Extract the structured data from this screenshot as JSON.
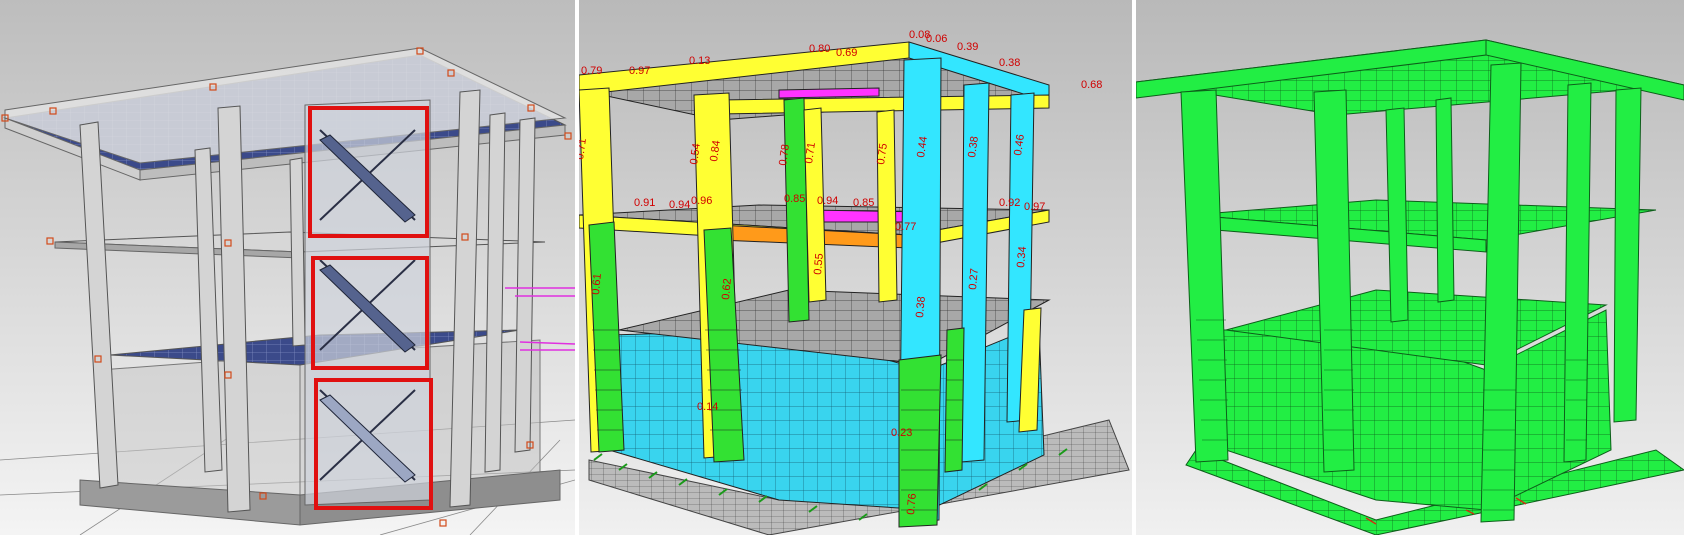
{
  "panels": [
    {
      "id": "geometry",
      "role": "3D structural model with highlighted staircases"
    },
    {
      "id": "utilization",
      "role": "element utilization ratio view"
    },
    {
      "id": "check",
      "role": "design check results view"
    }
  ],
  "colors": {
    "background_top": "#b9b9b9",
    "background_bottom": "#f3f3f3",
    "concrete": "#d9d9d9",
    "concrete_dark": "#9a9a9a",
    "slab_mesh": "#2e3c78",
    "highlight_box": "#e01010",
    "util_yellow": "#ffff33",
    "util_green": "#33e133",
    "util_cyan": "#33e6ff",
    "util_orange": "#ff9a1a",
    "util_magenta": "#ff33ff",
    "check_green": "#22ee44",
    "ground_mesh": "#8a8a8a",
    "label_red": "#d00000"
  },
  "utilization_labels": [
    {
      "text": "0.79"
    },
    {
      "text": "0.97"
    },
    {
      "text": "0.13"
    },
    {
      "text": "0.80"
    },
    {
      "text": "0.69"
    },
    {
      "text": "0.08"
    },
    {
      "text": "0.06"
    },
    {
      "text": "0.39"
    },
    {
      "text": "0.38"
    },
    {
      "text": "0.68"
    },
    {
      "text": "0.71"
    },
    {
      "text": "0.54"
    },
    {
      "text": "0.84"
    },
    {
      "text": "0.78"
    },
    {
      "text": "0.71"
    },
    {
      "text": "0.75"
    },
    {
      "text": "0.44"
    },
    {
      "text": "0.38"
    },
    {
      "text": "0.46"
    },
    {
      "text": "0.91"
    },
    {
      "text": "0.94"
    },
    {
      "text": "0.96"
    },
    {
      "text": "0.85"
    },
    {
      "text": "0.94"
    },
    {
      "text": "0.85"
    },
    {
      "text": "0.77"
    },
    {
      "text": "0.92"
    },
    {
      "text": "0.97"
    },
    {
      "text": "0.61"
    },
    {
      "text": "0.62"
    },
    {
      "text": "0.55"
    },
    {
      "text": "0.38"
    },
    {
      "text": "0.27"
    },
    {
      "text": "0.34"
    },
    {
      "text": "0.23"
    },
    {
      "text": "0.14"
    },
    {
      "text": "0.76"
    }
  ],
  "highlighted_staircases": 3
}
